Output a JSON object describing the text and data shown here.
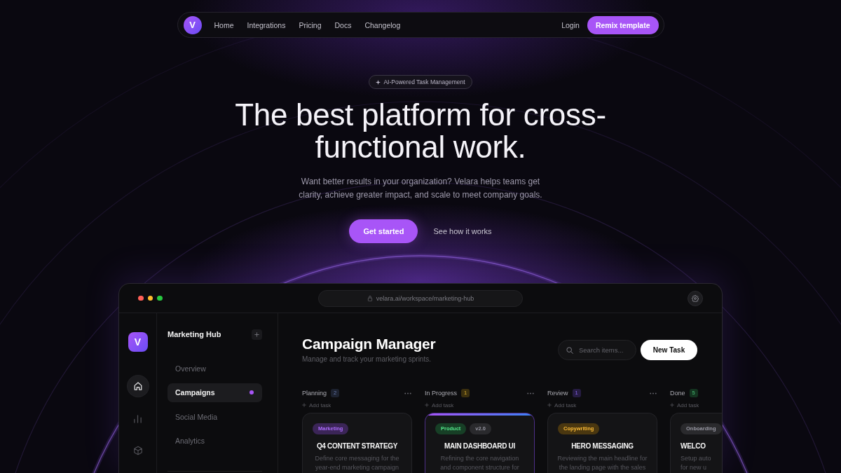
{
  "nav": {
    "logo": "V",
    "links": [
      {
        "label": "Home"
      },
      {
        "label": "Integrations"
      },
      {
        "label": "Pricing"
      },
      {
        "label": "Docs"
      },
      {
        "label": "Changelog"
      }
    ],
    "login": "Login",
    "cta": "Remix template"
  },
  "hero": {
    "badge": "AI-Powered Task Management",
    "title": "The best platform for cross-functional work.",
    "subtitle": "Want better results in your organization? Velara helps teams get clarity, achieve greater impact, and scale to meet company goals.",
    "primary_button": "Get started",
    "secondary_link": "See how it works"
  },
  "app": {
    "url": "velara.ai/workspace/marketing-hub",
    "rail": {
      "logo": "V",
      "items": [
        {
          "selected": true
        },
        {
          "selected": false
        },
        {
          "selected": false
        }
      ]
    },
    "sidebar": {
      "title": "Marketing Hub",
      "items": [
        {
          "label": "Overview",
          "selected": false
        },
        {
          "label": "Campaigns",
          "selected": true
        },
        {
          "label": "Social Media",
          "selected": false
        },
        {
          "label": "Analytics",
          "selected": false
        }
      ]
    },
    "header": {
      "title": "Campaign Manager",
      "subtitle": "Manage and track your marketing sprints.",
      "search": {
        "placeholder": "Search items..."
      },
      "new_button": "New Task"
    },
    "columns": [
      {
        "title": "Planning",
        "count": "2",
        "color": "#1d2230",
        "menu": true,
        "add_label": "Add task",
        "cards": [
          {
            "highlighted": false,
            "tags": [
              {
                "label": "Marketing",
                "color": "#3b2557"
              }
            ],
            "title": "Q4 CONTENT STRATEGY",
            "description": "Define core messaging for the\nyear-end marketing campaign"
          }
        ]
      },
      {
        "title": "In Progress",
        "count": "1",
        "color": "#3c300e",
        "menu": true,
        "add_label": "Add task",
        "cards": [
          {
            "highlighted": true,
            "tags": [
              {
                "label": "Product",
                "color": "#173f26"
              },
              {
                "label": "v2.0",
                "color": "#2a2a2d"
              }
            ],
            "title": "MAIN DASHBOARD UI",
            "description": "Refining the core navigation\nand component structure for"
          }
        ]
      },
      {
        "title": "Review",
        "count": "1",
        "color": "#261c42",
        "menu": true,
        "add_label": "Add task",
        "cards": [
          {
            "highlighted": false,
            "tags": [
              {
                "label": "Copywriting",
                "color": "#4a3710"
              }
            ],
            "title": "HERO MESSAGING",
            "description": "Reviewing the main headline for\nthe landing page with the sales"
          }
        ]
      },
      {
        "title": "Done",
        "count": "5",
        "color": "#143420",
        "menu": false,
        "add_label": "Add task",
        "cards": [
          {
            "highlighted": false,
            "tags": [
              {
                "label": "Onboarding",
                "color": "#2a2a2d"
              }
            ],
            "title": "WELCO",
            "description": "Setup auto\nfor new u"
          }
        ]
      }
    ]
  }
}
